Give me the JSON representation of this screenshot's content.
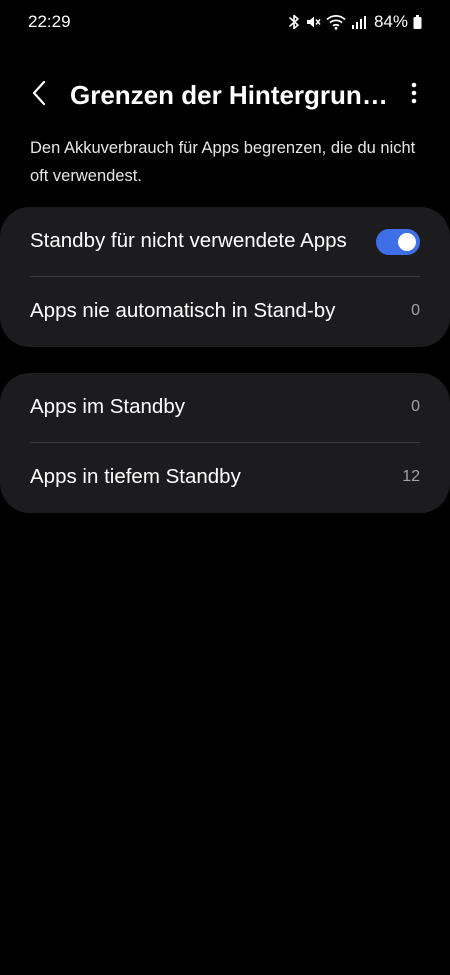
{
  "status_bar": {
    "time": "22:29",
    "battery": "84%",
    "icons": [
      "bluetooth-icon",
      "mute-icon",
      "wifi-icon",
      "signal-icon",
      "battery-icon"
    ]
  },
  "app_bar": {
    "title": "Grenzen der Hintergrun…",
    "back_icon": "chevron-left-icon",
    "more_icon": "more-vertical-icon"
  },
  "description": "Den Akkuverbrauch für Apps begrenzen, die du nicht oft verwendest.",
  "groups": [
    {
      "rows": [
        {
          "label": "Standby für nicht verwendete Apps",
          "toggle_on": true
        },
        {
          "label": "Apps nie automatisch in Stand-by",
          "count": "0"
        }
      ]
    },
    {
      "rows": [
        {
          "label": "Apps im Standby",
          "count": "0"
        },
        {
          "label": "Apps in tiefem Standby",
          "count": "12"
        }
      ]
    }
  ],
  "colors": {
    "background": "#000000",
    "card": "#1c1c1e",
    "accent": "#3e6fe6",
    "secondary_text": "#a3a3a3"
  }
}
